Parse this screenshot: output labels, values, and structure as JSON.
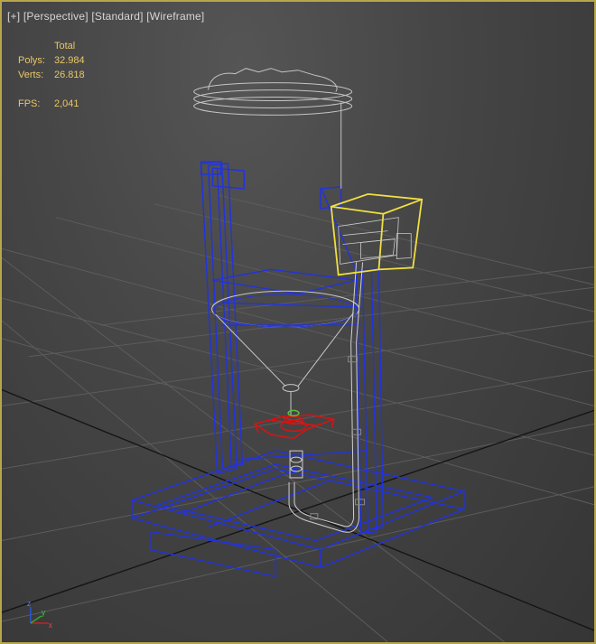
{
  "viewport": {
    "label": {
      "plus": "[+]",
      "view": "[Perspective]",
      "shading": "[Standard]",
      "mode": "[Wireframe]"
    },
    "stats": {
      "header": "Total",
      "polys_label": "Polys:",
      "polys_value": "32.984",
      "verts_label": "Verts:",
      "verts_value": "26.818",
      "fps_label": "FPS:",
      "fps_value": "2,041"
    },
    "axis_gizmo": {
      "z": "z",
      "x": "x",
      "y": "y"
    }
  },
  "colors": {
    "viewport_border": "#b8a64a",
    "grid": "#5a5a5a",
    "grid_axis": "#1a1a1a",
    "frame_wire": "#2233dd",
    "selected_wire": "#f0e040",
    "red_part": "#dd1111",
    "neutral_wire": "#c8c8c8",
    "stats_text": "#e8c866",
    "label_text": "#d6d6d6"
  }
}
